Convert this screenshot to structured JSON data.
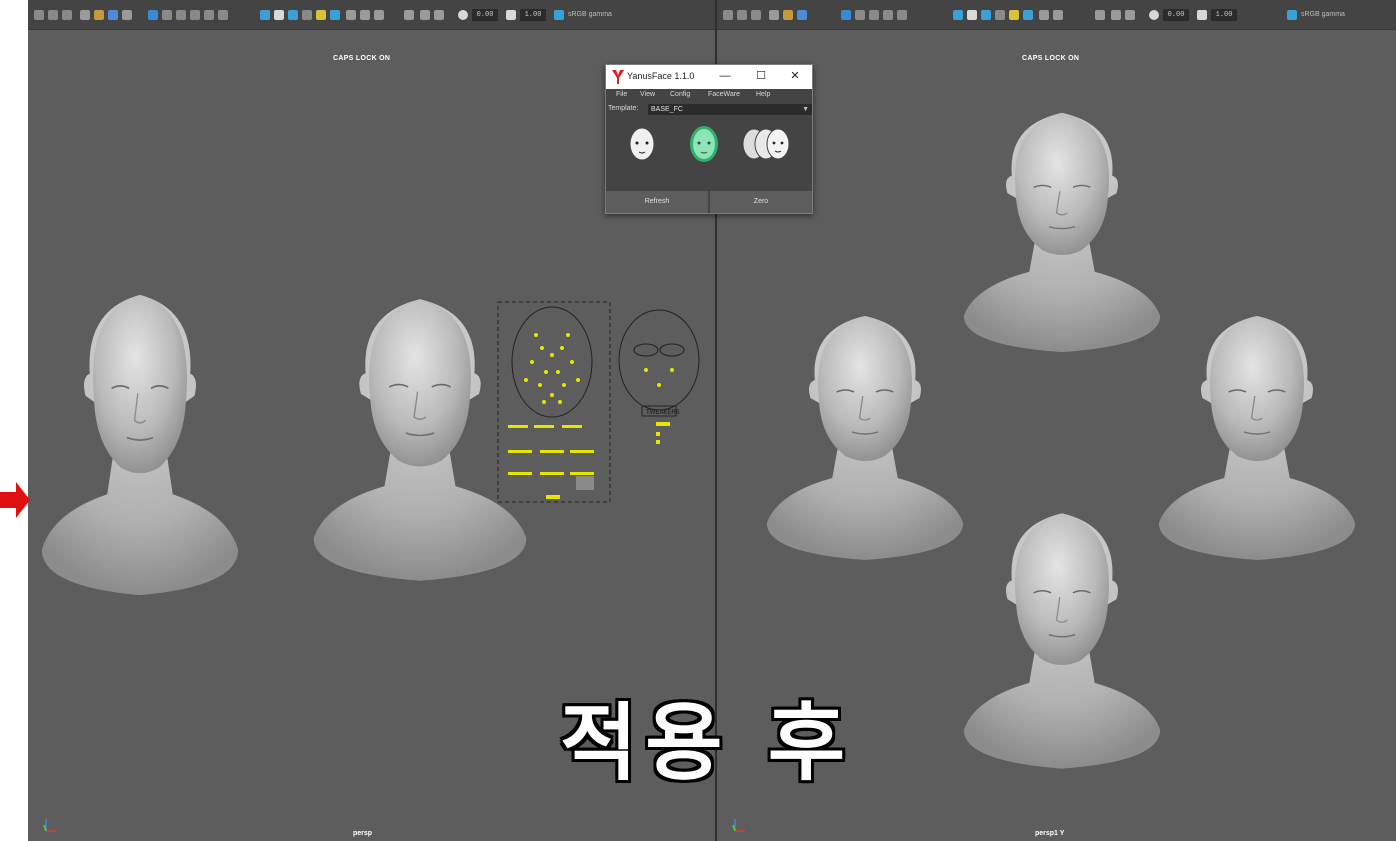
{
  "viewports": {
    "left": {
      "hud": "CAPS LOCK ON",
      "camera": "persp",
      "toolbar": {
        "value_a": "0.00",
        "value_b": "1.00",
        "gamma": "sRGB gamma"
      }
    },
    "right": {
      "hud": "CAPS LOCK ON",
      "camera": "persp1 Y",
      "toolbar": {
        "value_a": "0.00",
        "value_b": "1.00",
        "gamma": "sRGB gamma"
      }
    }
  },
  "overlay_text": "적용 후",
  "plugin": {
    "title": "YanusFace 1.1.0",
    "window_controls": {
      "minimize": "—",
      "maximize": "☐",
      "close": "✕"
    },
    "menu": [
      "File",
      "View",
      "Config",
      "FaceWare",
      "Help"
    ],
    "template_label": "Template:",
    "template_value": "BASE_FC",
    "buttons": {
      "refresh": "Refresh",
      "zero": "Zero"
    }
  },
  "facial_rig_panel": {
    "label": "TWEAKERS"
  },
  "colors": {
    "viewport_bg": "#5d5d5d",
    "toolbar_bg": "#444444",
    "rig_yellow": "#e6e600",
    "active_green": "#5fd39a",
    "arrow_red": "#e01010"
  }
}
